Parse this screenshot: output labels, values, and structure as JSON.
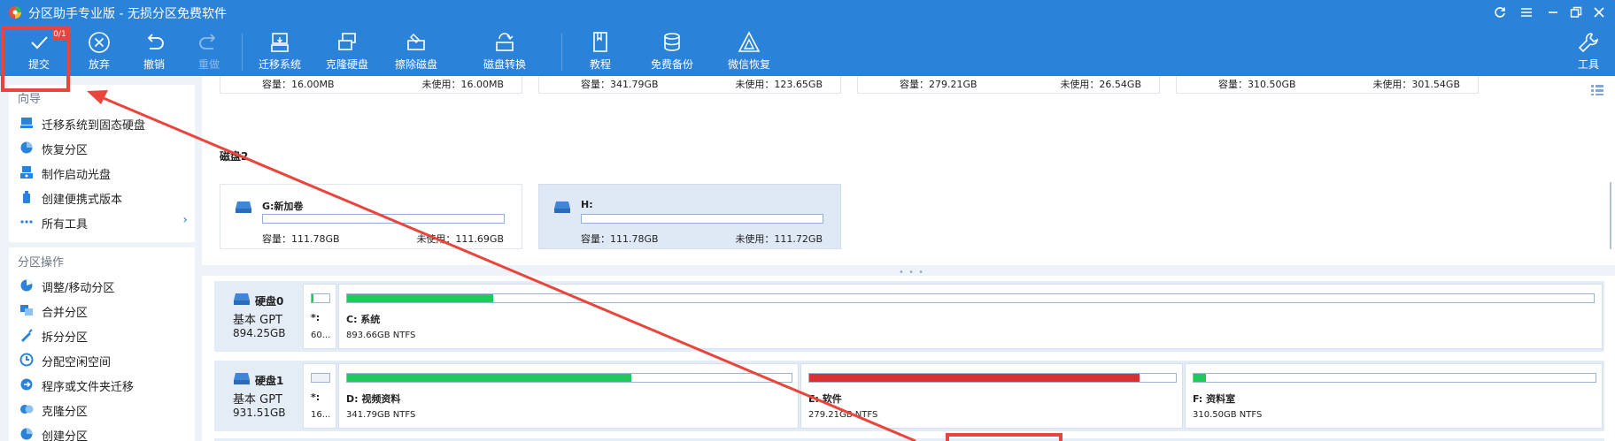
{
  "window": {
    "title": "分区助手专业版 - 无损分区免费软件"
  },
  "toolbar": {
    "badge": "0/1",
    "items": [
      {
        "label": "提交"
      },
      {
        "label": "放弃"
      },
      {
        "label": "撤销"
      },
      {
        "label": "重做"
      },
      {
        "label": "迁移系统"
      },
      {
        "label": "克隆硬盘"
      },
      {
        "label": "擦除磁盘"
      },
      {
        "label": "磁盘转换"
      },
      {
        "label": "教程"
      },
      {
        "label": "免费备份"
      },
      {
        "label": "微信恢复"
      },
      {
        "label": "工具"
      }
    ]
  },
  "sidebar": {
    "wizard_title": "向导",
    "wizard_items": [
      {
        "label": "迁移系统到固态硬盘"
      },
      {
        "label": "恢复分区"
      },
      {
        "label": "制作启动光盘"
      },
      {
        "label": "创建便携式版本"
      },
      {
        "label": "所有工具"
      }
    ],
    "partition_title": "分区操作",
    "partition_items": [
      {
        "label": "调整/移动分区"
      },
      {
        "label": "合并分区"
      },
      {
        "label": "拆分分区"
      },
      {
        "label": "分配空闲空间"
      },
      {
        "label": "程序或文件夹迁移"
      },
      {
        "label": "克隆分区"
      },
      {
        "label": "创建分区"
      }
    ]
  },
  "upper_view": {
    "top_tiles": [
      {
        "cap": "容量：16.00MB",
        "free": "未使用：16.00MB"
      },
      {
        "cap": "容量：341.79GB",
        "free": "未使用：123.65GB"
      },
      {
        "cap": "容量：279.21GB",
        "free": "未使用：26.54GB"
      },
      {
        "cap": "容量：310.50GB",
        "free": "未使用：301.54GB"
      }
    ],
    "disk_label": "磁盘2",
    "volumes": [
      {
        "name": "G:新加卷",
        "cap": "容量：111.78GB",
        "free": "未使用：111.69GB",
        "used_fraction": 0.001
      },
      {
        "name": "H:",
        "cap": "容量：111.78GB",
        "free": "未使用：111.72GB",
        "used_fraction": 0.0
      }
    ]
  },
  "disk_map": {
    "disks": [
      {
        "name": "硬盘0",
        "type": "基本 GPT",
        "size": "894.25GB",
        "partitions": [
          {
            "name": "*:",
            "desc": "60...",
            "used_fraction": 0.1,
            "color": "#1fc95b"
          },
          {
            "name": "C: 系统",
            "desc": "893.66GB NTFS",
            "used_fraction": 0.117,
            "color": "#1fc95b"
          }
        ]
      },
      {
        "name": "硬盘1",
        "type": "基本 GPT",
        "size": "931.51GB",
        "partitions": [
          {
            "name": "*:",
            "desc": "16...",
            "used_fraction": 0.0,
            "color": "#1fc95b"
          },
          {
            "name": "D: 视频资料",
            "desc": "341.79GB NTFS",
            "used_fraction": 0.64,
            "color": "#1fc95b"
          },
          {
            "name": "E: 软件",
            "desc": "279.21GB NTFS",
            "used_fraction": 0.9,
            "color": "#d93030"
          },
          {
            "name": "F: 资料室",
            "desc": "310.50GB NTFS",
            "used_fraction": 0.03,
            "color": "#1fc95b"
          }
        ]
      }
    ]
  },
  "colors": {
    "toolbar_bg": "#2b82d9",
    "annotation_red": "#e8453c",
    "used_green": "#1fc95b",
    "used_red": "#d93030"
  }
}
